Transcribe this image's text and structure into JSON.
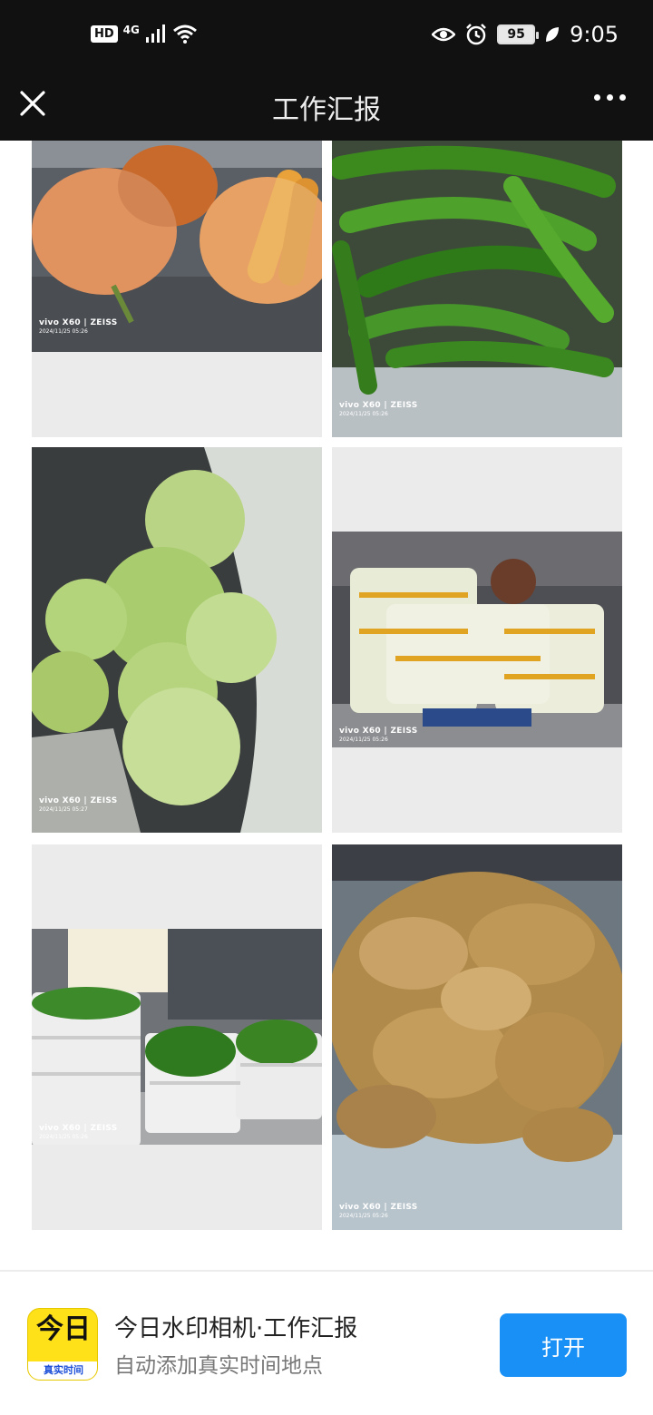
{
  "status_bar": {
    "hd": "HD",
    "network": "4G",
    "battery": "95",
    "time": "9:05",
    "icons": [
      "signal-icon",
      "wifi-icon",
      "eye-icon",
      "alarm-icon",
      "battery-icon",
      "leaf-icon"
    ]
  },
  "nav": {
    "title": "工作汇报",
    "close_icon": "close-icon",
    "more_icon": "more-icon"
  },
  "photos": [
    {
      "subject": "carrots",
      "watermark_brand": "vivo X60 | ZEISS",
      "watermark_date": "2024/11/25 05:26"
    },
    {
      "subject": "green-peppers",
      "watermark_brand": "vivo X60 | ZEISS",
      "watermark_date": "2024/11/25 05:26"
    },
    {
      "subject": "cabbages",
      "watermark_brand": "vivo X60 | ZEISS",
      "watermark_date": "2024/11/25 05:27"
    },
    {
      "subject": "napa-cabbage",
      "watermark_brand": "vivo X60 | ZEISS",
      "watermark_date": "2024/11/25 05:26"
    },
    {
      "subject": "leafy-greens",
      "watermark_brand": "vivo X60 | ZEISS",
      "watermark_date": "2024/11/25 05:26"
    },
    {
      "subject": "ginger",
      "watermark_brand": "vivo X60 | ZEISS",
      "watermark_date": "2024/11/25 05:26"
    }
  ],
  "promo": {
    "icon_text": "今日",
    "icon_band": "真实时间",
    "title": "今日水印相机·工作汇报",
    "subtitle": "自动添加真实时间地点",
    "open_label": "打开"
  },
  "colors": {
    "header_bg": "#111111",
    "button_blue": "#1890f5",
    "app_yellow": "#ffe11a",
    "tile_bg": "#ebebeb"
  }
}
